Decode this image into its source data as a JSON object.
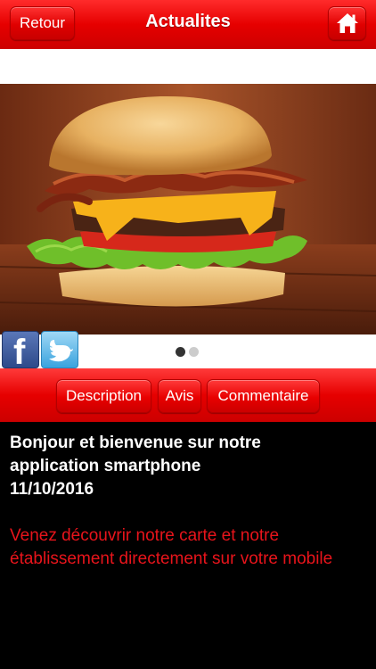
{
  "header": {
    "back_label": "Retour",
    "title": "Actualites",
    "home_icon": "home-icon"
  },
  "carousel": {
    "image": "burger-photo",
    "page_count": 2,
    "active_page": 1
  },
  "social": {
    "facebook_icon": "facebook-icon",
    "twitter_icon": "twitter-icon"
  },
  "tabs": [
    {
      "label": "Description"
    },
    {
      "label": "Avis"
    },
    {
      "label": "Commentaire"
    }
  ],
  "content": {
    "headline_line1": "Bonjour et bienvenue sur notre",
    "headline_line2": "application smartphone",
    "date": "11/10/2016",
    "body": "Venez découvrir notre carte et notre établissement directement sur votre mobile"
  },
  "colors": {
    "brand_red": "#e60000",
    "body_text_red": "#e8141b",
    "background": "#000000"
  }
}
